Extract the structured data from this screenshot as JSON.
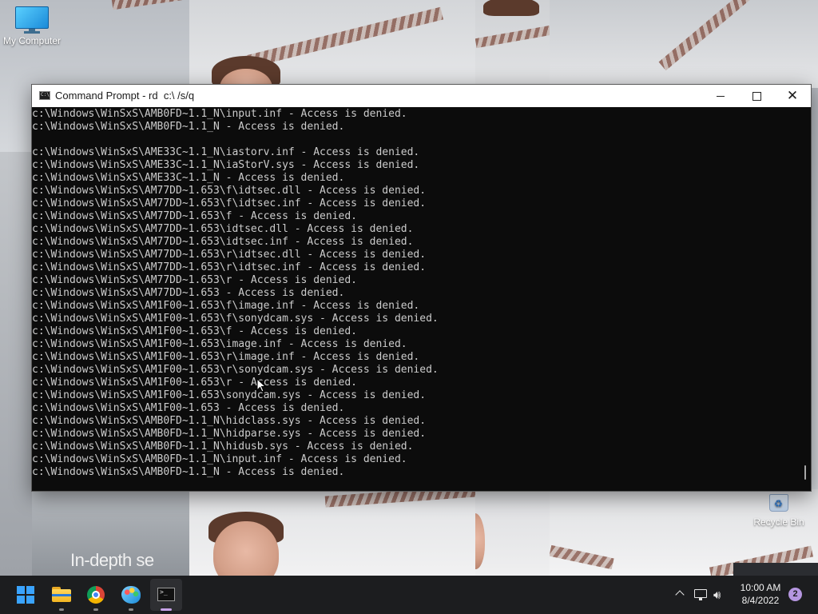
{
  "desktop": {
    "icons": [
      {
        "label": "My Computer",
        "icon": "monitor-icon"
      },
      {
        "label": "Recycle Bin",
        "icon": "recycle-bin-icon"
      }
    ],
    "wallpaper_text": "In-depth se"
  },
  "window": {
    "title": "Command Prompt - rd  c:\\ /s/q",
    "controls": {
      "minimize": "minimize-icon",
      "maximize": "maximize-icon",
      "close": "close-icon"
    },
    "output_lines": [
      "c:\\Windows\\WinSxS\\AMB0FD~1.1_N\\input.inf - Access is denied.",
      "c:\\Windows\\WinSxS\\AMB0FD~1.1_N - Access is denied.",
      "",
      "c:\\Windows\\WinSxS\\AME33C~1.1_N\\iastorv.inf - Access is denied.",
      "c:\\Windows\\WinSxS\\AME33C~1.1_N\\iaStorV.sys - Access is denied.",
      "c:\\Windows\\WinSxS\\AME33C~1.1_N - Access is denied.",
      "c:\\Windows\\WinSxS\\AM77DD~1.653\\f\\idtsec.dll - Access is denied.",
      "c:\\Windows\\WinSxS\\AM77DD~1.653\\f\\idtsec.inf - Access is denied.",
      "c:\\Windows\\WinSxS\\AM77DD~1.653\\f - Access is denied.",
      "c:\\Windows\\WinSxS\\AM77DD~1.653\\idtsec.dll - Access is denied.",
      "c:\\Windows\\WinSxS\\AM77DD~1.653\\idtsec.inf - Access is denied.",
      "c:\\Windows\\WinSxS\\AM77DD~1.653\\r\\idtsec.dll - Access is denied.",
      "c:\\Windows\\WinSxS\\AM77DD~1.653\\r\\idtsec.inf - Access is denied.",
      "c:\\Windows\\WinSxS\\AM77DD~1.653\\r - Access is denied.",
      "c:\\Windows\\WinSxS\\AM77DD~1.653 - Access is denied.",
      "c:\\Windows\\WinSxS\\AM1F00~1.653\\f\\image.inf - Access is denied.",
      "c:\\Windows\\WinSxS\\AM1F00~1.653\\f\\sonydcam.sys - Access is denied.",
      "c:\\Windows\\WinSxS\\AM1F00~1.653\\f - Access is denied.",
      "c:\\Windows\\WinSxS\\AM1F00~1.653\\image.inf - Access is denied.",
      "c:\\Windows\\WinSxS\\AM1F00~1.653\\r\\image.inf - Access is denied.",
      "c:\\Windows\\WinSxS\\AM1F00~1.653\\r\\sonydcam.sys - Access is denied.",
      "c:\\Windows\\WinSxS\\AM1F00~1.653\\r - Access is denied.",
      "c:\\Windows\\WinSxS\\AM1F00~1.653\\sonydcam.sys - Access is denied.",
      "c:\\Windows\\WinSxS\\AM1F00~1.653 - Access is denied.",
      "c:\\Windows\\WinSxS\\AMB0FD~1.1_N\\hidclass.sys - Access is denied.",
      "c:\\Windows\\WinSxS\\AMB0FD~1.1_N\\hidparse.sys - Access is denied.",
      "c:\\Windows\\WinSxS\\AMB0FD~1.1_N\\hidusb.sys - Access is denied.",
      "c:\\Windows\\WinSxS\\AMB0FD~1.1_N\\input.inf - Access is denied.",
      "c:\\Windows\\WinSxS\\AMB0FD~1.1_N - Access is denied."
    ],
    "colors": {
      "console_bg": "#0c0c0c",
      "console_text": "#cccccc",
      "titlebar_bg": "#ffffff"
    }
  },
  "taskbar": {
    "apps": [
      {
        "name": "start",
        "icon": "windows-start-icon"
      },
      {
        "name": "file-explorer",
        "icon": "folder-icon"
      },
      {
        "name": "chrome",
        "icon": "chrome-icon"
      },
      {
        "name": "paint",
        "icon": "paint-palette-icon"
      },
      {
        "name": "command-prompt",
        "icon": "terminal-icon",
        "active": true
      }
    ],
    "tray": {
      "time": "10:00 AM",
      "date": "8/4/2022",
      "notification_count": "2"
    },
    "colors": {
      "background": "#1c1d1f",
      "active_indicator": "#c7a3e8",
      "badge": "#b596e0"
    }
  }
}
